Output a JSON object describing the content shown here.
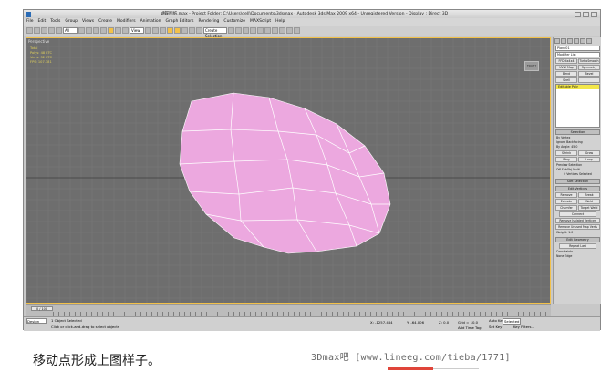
{
  "window": {
    "title": "蝴蝶图纸.max    - Project Folder: C:\\Users\\dell\\Documents\\3dsmax    - Autodesk 3ds Max  2009 x64    - Unregistered Version    - Display : Direct 3D"
  },
  "menu": [
    "File",
    "Edit",
    "Tools",
    "Group",
    "Views",
    "Create",
    "Modifiers",
    "Animation",
    "Graph Editors",
    "Rendering",
    "Customize",
    "MAXScript",
    "Help"
  ],
  "toolbar": {
    "selection_filter": "All",
    "ref_coord": "View",
    "named_selection": "Create Selection Set"
  },
  "viewport": {
    "label": "Perspective",
    "stats": [
      "Total",
      "Polys: 48 ETC",
      "Verts: 32 ETC",
      "",
      "FPS: 107.381"
    ],
    "viewcube": "FRONT",
    "mesh_color": "#eca8df",
    "background_color": "#6e6e6e",
    "grid_color": "#7b7b7b",
    "border_color": "#f2c14a"
  },
  "command_panel": {
    "object_name": "Plane01",
    "modifier_list": "Modifier List",
    "buttons": [
      "FFD 4x4x4",
      "TurboSmooth",
      "UVW Map",
      "Symmetry",
      "Bend",
      "Bevel",
      "Shell",
      ""
    ],
    "stack_item": "Editable Poly",
    "selection_rollout": "Selection",
    "selection_opts": [
      "By Vertex",
      "Ignore Backfacing",
      "By Angle: 45.0"
    ],
    "selection_btns": [
      "Shrink",
      "Grow",
      "Ring",
      "Loop"
    ],
    "preview_label": "Preview Selection",
    "preview_opts": "Off  SubObj  Multi",
    "selected_info": "0 Vertices Selected",
    "soft_selection": "Soft Selection",
    "edit_vertices": "Edit Vertices",
    "edit_btns": [
      "Remove",
      "Break",
      "Extrude",
      "Weld",
      "Chamfer",
      "Target Weld"
    ],
    "connect": "Connect",
    "remove_isolated": "Remove Isolated Vertices",
    "remove_unused": "Remove Unused Map Verts",
    "weight": "Weight:",
    "weight_value": "1.0",
    "edit_geometry": "Edit Geometry",
    "repeat_last": "Repeat Last",
    "constraints": "Constraints",
    "constraint_opts": "None  Edge"
  },
  "timeline": {
    "frame": "0 / 100",
    "ticks": [
      "0",
      "5",
      "10",
      "15",
      "20",
      "25",
      "30",
      "35",
      "40",
      "45",
      "50",
      "55",
      "60",
      "65",
      "70",
      "75",
      "80",
      "85",
      "90",
      "95",
      "100"
    ]
  },
  "status": {
    "maxscript": "Design",
    "selected": "1 Object Selected",
    "prompt": "Click or click-and-drag to select objects",
    "x_label": "X:",
    "x_value": "-1257.464",
    "y_label": "Y:",
    "y_value": "-64.006",
    "z_label": "Z:",
    "z_value": "0.0",
    "grid": "Grid = 10.0",
    "autokey": "Auto Key",
    "selected_dd": "Selected",
    "setkey": "Set Key",
    "keyfilters": "Key Filters...",
    "add_time_tag": "Add Time Tag"
  },
  "caption": "移动点形成上图样子。",
  "watermark": "3Dmax吧  [www.lineeg.com/tieba/1771]"
}
